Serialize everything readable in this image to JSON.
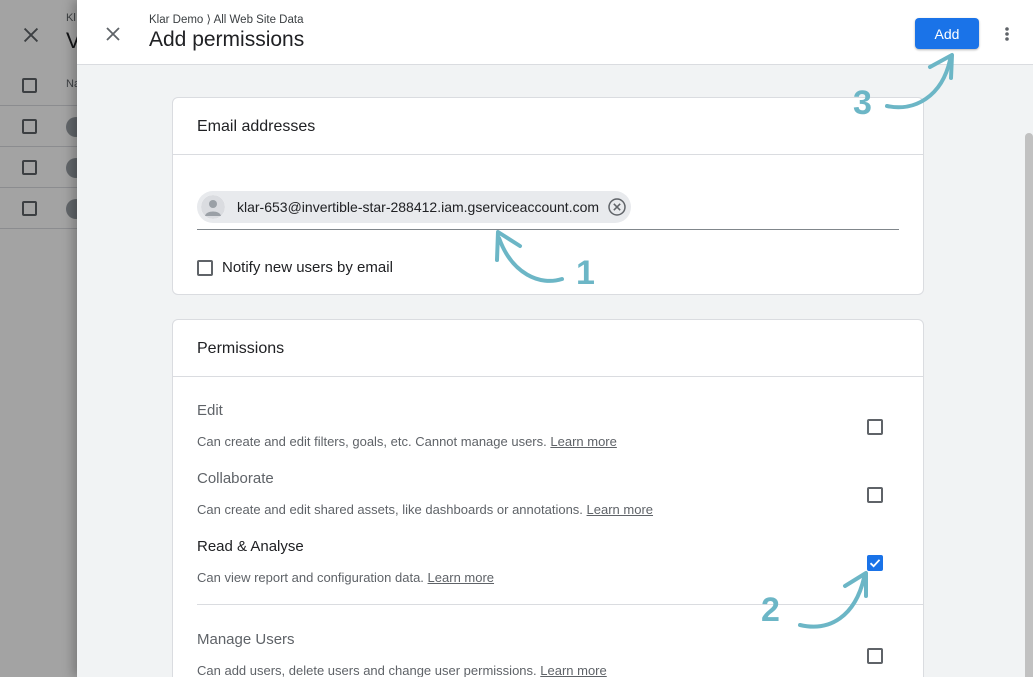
{
  "background": {
    "breadcrumb": "Kl",
    "title": "V",
    "column_header": "Na"
  },
  "dialog": {
    "breadcrumb": "Klar Demo ⟩ All Web Site Data",
    "title": "Add permissions",
    "add_label": "Add"
  },
  "email_section": {
    "heading": "Email addresses",
    "chip_email": "klar-653@invertible-star-288412.iam.gserviceaccount.com",
    "notify_label": "Notify new users by email",
    "notify_checked": false
  },
  "permissions_section": {
    "heading": "Permissions",
    "items": [
      {
        "name": "Edit",
        "description": "Can create and edit filters, goals, etc. Cannot manage users.",
        "link": "Learn more",
        "checked": false
      },
      {
        "name": "Collaborate",
        "description": "Can create and edit shared assets, like dashboards or annotations.",
        "link": "Learn more",
        "checked": false
      },
      {
        "name": "Read & Analyse",
        "description": "Can view report and configuration data.",
        "link": "Learn more",
        "checked": true
      },
      {
        "name": "Manage Users",
        "description": "Can add users, delete users and change user permissions.",
        "link": "Learn more",
        "checked": false
      }
    ]
  },
  "annotations": {
    "step1": "1",
    "step2": "2",
    "step3": "3",
    "color": "#6cb6c6"
  },
  "colors": {
    "primary": "#1a73e8",
    "scrim": "rgba(0,0,0,0.36)"
  }
}
